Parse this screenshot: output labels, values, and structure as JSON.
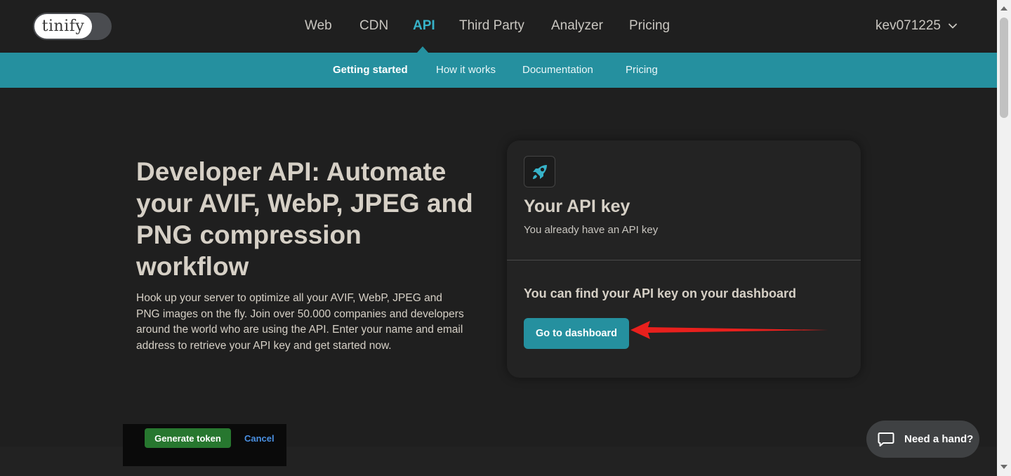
{
  "brand": {
    "logo_text": "tinify"
  },
  "nav": {
    "items": [
      {
        "label": "Web"
      },
      {
        "label": "CDN"
      },
      {
        "label": "API"
      },
      {
        "label": "Third Party"
      },
      {
        "label": "Analyzer"
      },
      {
        "label": "Pricing"
      }
    ],
    "active": "API",
    "user": "kev071225"
  },
  "subnav": {
    "items": [
      {
        "label": "Getting started"
      },
      {
        "label": "How it works"
      },
      {
        "label": "Documentation"
      },
      {
        "label": "Pricing"
      }
    ],
    "active": "Getting started"
  },
  "hero": {
    "title": "Developer API: Automate your AVIF, WebP, JPEG and PNG compression workflow",
    "text": "Hook up your server to optimize all your AVIF, WebP, JPEG and PNG images on the fly. Join over 50.000 companies and developers around the world who are using the API. Enter your name and email address to retrieve your API key and get started now."
  },
  "api_card": {
    "icon": "rocket-icon",
    "title": "Your API key",
    "subtitle": "You already have an API key",
    "find_text": "You can find your API key on your dashboard",
    "button_label": "Go to dashboard"
  },
  "token_bar": {
    "generate_label": "Generate token",
    "cancel_label": "Cancel"
  },
  "help": {
    "label": "Need a hand?"
  },
  "colors": {
    "background": "#1f1f1f",
    "accent": "#25909f",
    "accent_text": "#37b2c8",
    "generate_green": "#27772f",
    "arrow_red": "#e8201d"
  }
}
